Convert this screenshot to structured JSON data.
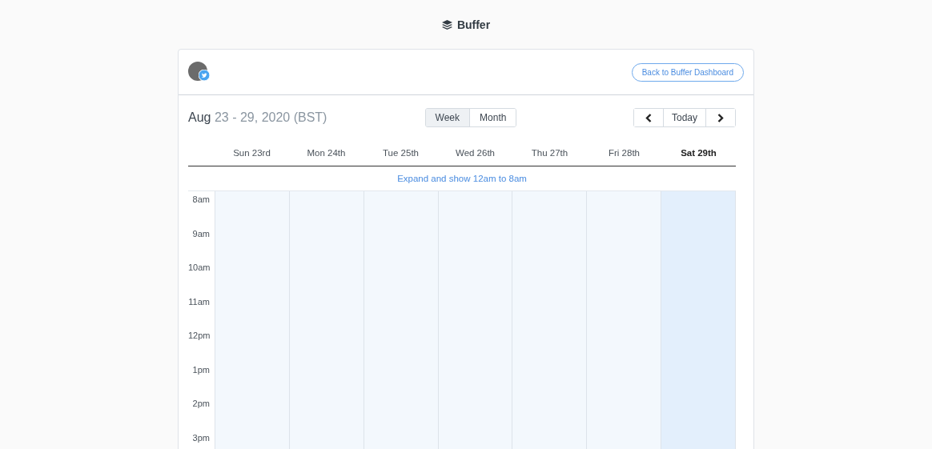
{
  "brand": {
    "name": "Buffer"
  },
  "header": {
    "button": "Back to Buffer Dashboard"
  },
  "toolbar": {
    "month": "Aug",
    "range": "23 - 29, 2020 (BST)",
    "views": [
      {
        "label": "Week",
        "selected": true
      },
      {
        "label": "Month",
        "selected": false
      }
    ],
    "today": "Today"
  },
  "days": [
    {
      "label": "Sun 23rd",
      "today": false
    },
    {
      "label": "Mon 24th",
      "today": false
    },
    {
      "label": "Tue 25th",
      "today": false
    },
    {
      "label": "Wed 26th",
      "today": false
    },
    {
      "label": "Thu 27th",
      "today": false
    },
    {
      "label": "Fri 28th",
      "today": false
    },
    {
      "label": "Sat 29th",
      "today": true
    }
  ],
  "expand_link": "Expand and show 12am to 8am",
  "hours": [
    "8am",
    "9am",
    "10am",
    "11am",
    "12pm",
    "1pm",
    "2pm",
    "3pm"
  ]
}
